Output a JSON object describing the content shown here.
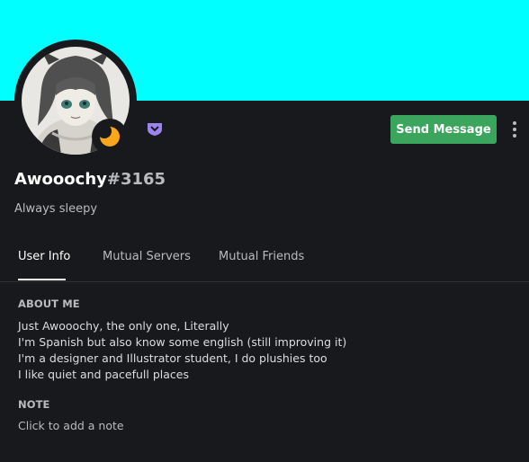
{
  "banner": {
    "color": "#00ffff"
  },
  "profile": {
    "username": "Awooochy",
    "discriminator": "#3165",
    "custom_status": "Always sleepy",
    "status": "idle",
    "badge": "hypesquad-balance-icon"
  },
  "actions": {
    "send_message_label": "Send Message",
    "more_icon": "more-vertical-icon"
  },
  "tabs": [
    {
      "label": "User Info",
      "active": true
    },
    {
      "label": "Mutual Servers",
      "active": false
    },
    {
      "label": "Mutual Friends",
      "active": false
    }
  ],
  "about": {
    "title": "ABOUT ME",
    "lines": [
      "Just Awooochy, the only one, Literally",
      "I'm Spanish but also know some english (still improving it)",
      "I'm a designer and Illustrator student, I do plushies too",
      "I like quiet and pacefull places"
    ]
  },
  "note": {
    "title": "NOTE",
    "placeholder": "Click to add a note"
  },
  "colors": {
    "accent_green": "#3ba55d",
    "idle_yellow": "#faa61a",
    "badge_purple": "#9c84ef",
    "background": "#18191c"
  }
}
